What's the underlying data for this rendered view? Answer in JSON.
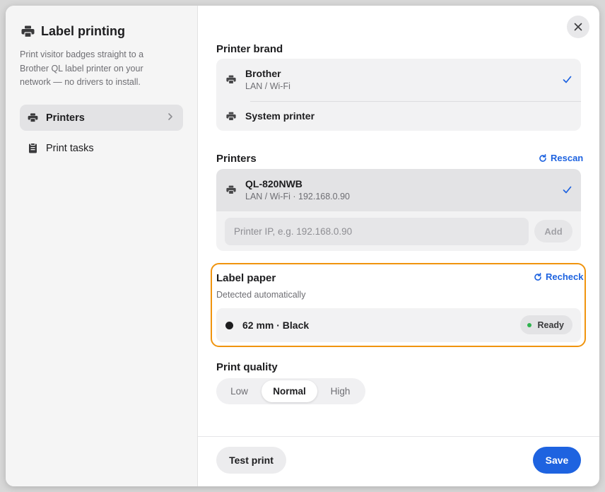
{
  "sidebar": {
    "title": "Label printing",
    "description": "Print visitor badges straight to a Brother QL label printer on your network — no drivers to install.",
    "items": [
      {
        "label": "Printers",
        "icon": "printer-icon",
        "active": true
      },
      {
        "label": "Print tasks",
        "icon": "clipboard-icon",
        "active": false
      }
    ]
  },
  "brand": {
    "title": "Printer brand",
    "options": [
      {
        "name": "Brother",
        "sub": "LAN / Wi-Fi",
        "selected": true
      },
      {
        "name": "System printer",
        "sub": "",
        "selected": false
      }
    ]
  },
  "printers": {
    "title": "Printers",
    "rescan_label": "Rescan",
    "items": [
      {
        "name": "QL-820NWB",
        "sub": "LAN / Wi-Fi · 192.168.0.90",
        "selected": true
      }
    ],
    "ip_placeholder": "Printer IP, e.g. 192.168.0.90",
    "add_label": "Add"
  },
  "paper": {
    "title": "Label paper",
    "recheck_label": "Recheck",
    "subtitle": "Detected automatically",
    "name": "62 mm · Black",
    "status": "Ready"
  },
  "quality": {
    "title": "Print quality",
    "options": [
      "Low",
      "Normal",
      "High"
    ],
    "selected": "Normal"
  },
  "footer": {
    "test_label": "Test print",
    "save_label": "Save"
  },
  "colors": {
    "accent": "#1e63e0",
    "highlight_border": "#f0940e",
    "ready_dot": "#2fb34e"
  }
}
